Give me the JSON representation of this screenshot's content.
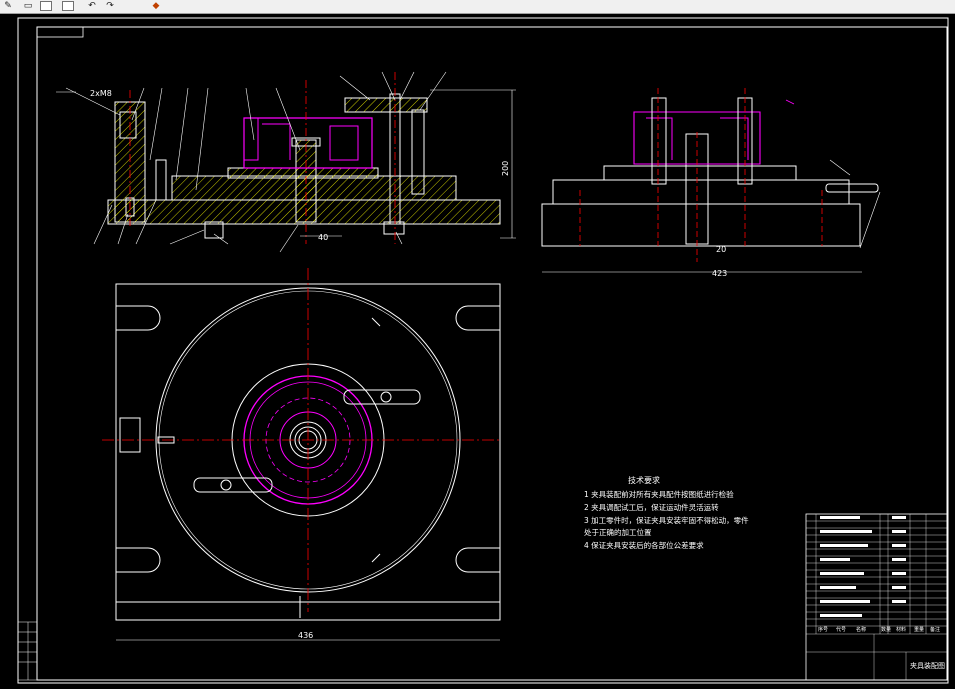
{
  "toolbar": {
    "icons": [
      "pencil-icon",
      "save-icon",
      "undo-icon",
      "redo-icon",
      "layers-icon"
    ]
  },
  "drawing": {
    "dimensions": {
      "left_height": "200",
      "left_width_small": "40",
      "right_width": "423",
      "right_width_small": "20",
      "plan_width": "436",
      "left_callout": "2xM8"
    },
    "tech_requirements": {
      "title": "技术要求",
      "items": [
        "1  夹具装配前对所有夹具配件按图纸进行检验",
        "2  夹具调配试工后，保证运动件灵活运转",
        "3  加工零件时，保证夹具安装牢固不得松动，零件",
        "   处于正确的加工位置",
        "4  保证夹具安装后的各部位公差要求"
      ]
    },
    "title_block": {
      "headers": [
        "序号",
        "代号",
        "名称",
        "数量",
        "材料",
        "重量",
        "备注"
      ],
      "drawing_name": "夹具装配图"
    }
  },
  "colors": {
    "background": "#000000",
    "lines": "#ffffff",
    "accent": "#ff00ff",
    "center_lines": "#ff0000",
    "hatch": "#ffff00"
  }
}
